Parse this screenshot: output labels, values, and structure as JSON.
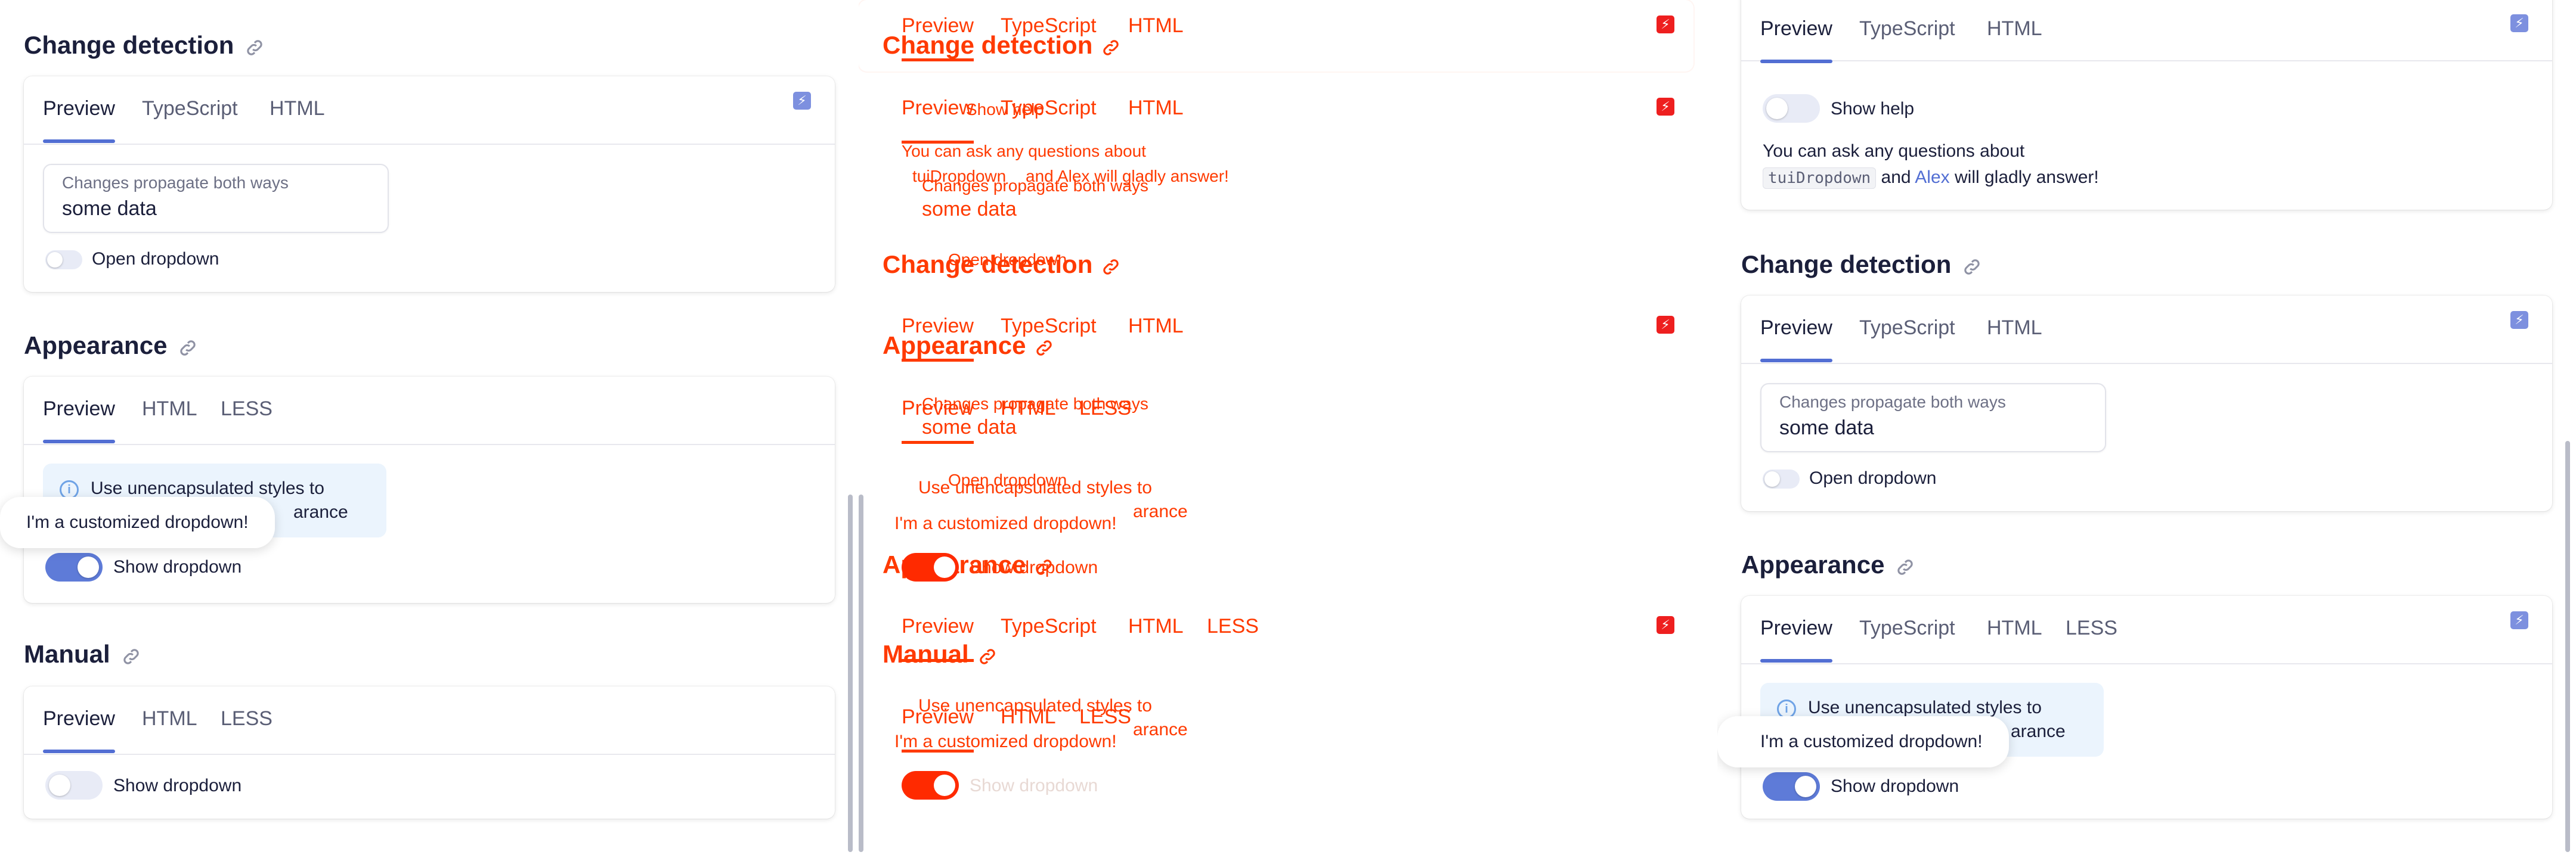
{
  "common": {
    "tab_preview": "Preview",
    "tab_typescript": "TypeScript",
    "tab_html": "HTML",
    "tab_less": "LESS",
    "bolt_glyph": "⚡",
    "info_glyph": "i"
  },
  "left": {
    "change_detection": {
      "title": "Change detection",
      "field_label": "Changes propagate both ways",
      "field_value": "some data",
      "toggle_label": "Open dropdown"
    },
    "appearance": {
      "title": "Appearance",
      "notice_line1": "Use unencapsulated styles to",
      "notice_line2": "arance",
      "popup": "I'm a customized dropdown!",
      "toggle_label": "Show dropdown"
    },
    "manual": {
      "title": "Manual",
      "toggle_label": "Show dropdown"
    }
  },
  "middle": {
    "row1_tabs": [
      "Preview",
      "TypeScript",
      "HTML"
    ],
    "title_change_detection": "Change detection",
    "row2_tabs": [
      "Preview",
      "TypeScript",
      "HTML"
    ],
    "show_help": "Show help",
    "help_line1": "You can ask any questions about",
    "help_line2_code": "tuiDropdown",
    "help_line2_rest": "and Alex will gladly answer!",
    "field_label": "Changes propagate both ways",
    "field_value": "some data",
    "open_dropdown": "Open dropdown",
    "title_change_detection_2": "Change detection",
    "row3_tabs": [
      "Preview",
      "TypeScript",
      "HTML"
    ],
    "title_appearance": "Appearance",
    "row4_tabs": [
      "Preview",
      "HTML",
      "LESS"
    ],
    "field_label_2": "Changes propagate both ways",
    "field_value_2": "some data",
    "open_dropdown_2": "Open dropdown",
    "notice_line1": "Use unencapsulated styles to",
    "notice_line2": "arance",
    "popup": "I'm a customized dropdown!",
    "title_appearance_2": "Appearance",
    "show_dropdown": "Show dropdown",
    "row5_tabs": [
      "Preview",
      "TypeScript",
      "HTML",
      "LESS"
    ],
    "title_manual": "Manual",
    "notice2_line1": "Use unencapsulated styles to",
    "notice2_line2": "arance",
    "row6_tabs": [
      "Preview",
      "HTML",
      "LESS"
    ],
    "popup_2": "I'm a customized dropdown!",
    "show_dropdown_2": "Show dropdown"
  },
  "right": {
    "top": {
      "show_help": "Show help",
      "help_line1": "You can ask any questions about",
      "help_code": "tuiDropdown",
      "help_and": "and",
      "help_link": "Alex",
      "help_rest": "will gladly answer!"
    },
    "change_detection": {
      "title": "Change detection",
      "field_label": "Changes propagate both ways",
      "field_value": "some data",
      "toggle_label": "Open dropdown"
    },
    "appearance": {
      "title": "Appearance",
      "notice_line1": "Use unencapsulated styles to",
      "notice_line2": "arance",
      "popup": "I'm a customized dropdown!",
      "toggle_label": "Show dropdown"
    }
  },
  "colors": {
    "accent": "#526ed3",
    "toggle_on": "#5e7bd8",
    "toggle_off": "#e8ebf6",
    "diff_red": "#ff3a00",
    "notice_bg": "#ebf4fd"
  }
}
